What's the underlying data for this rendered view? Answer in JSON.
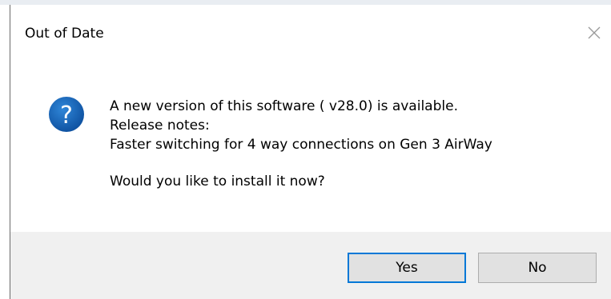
{
  "dialog": {
    "title": "Out of Date",
    "close_icon": "close-icon",
    "icon": "question-icon",
    "message": {
      "line1": "A new version of this software ( v28.0) is available.",
      "line2": "Release notes:",
      "line3": "Faster switching for 4 way connections on Gen 3 AirWay",
      "line4": "Would you like to install it now?"
    },
    "buttons": {
      "yes_label": "Yes",
      "no_label": "No"
    },
    "colors": {
      "icon_blue": "#1565c0",
      "focus_border": "#0078d7",
      "footer_bg": "#f0f0f0"
    }
  }
}
